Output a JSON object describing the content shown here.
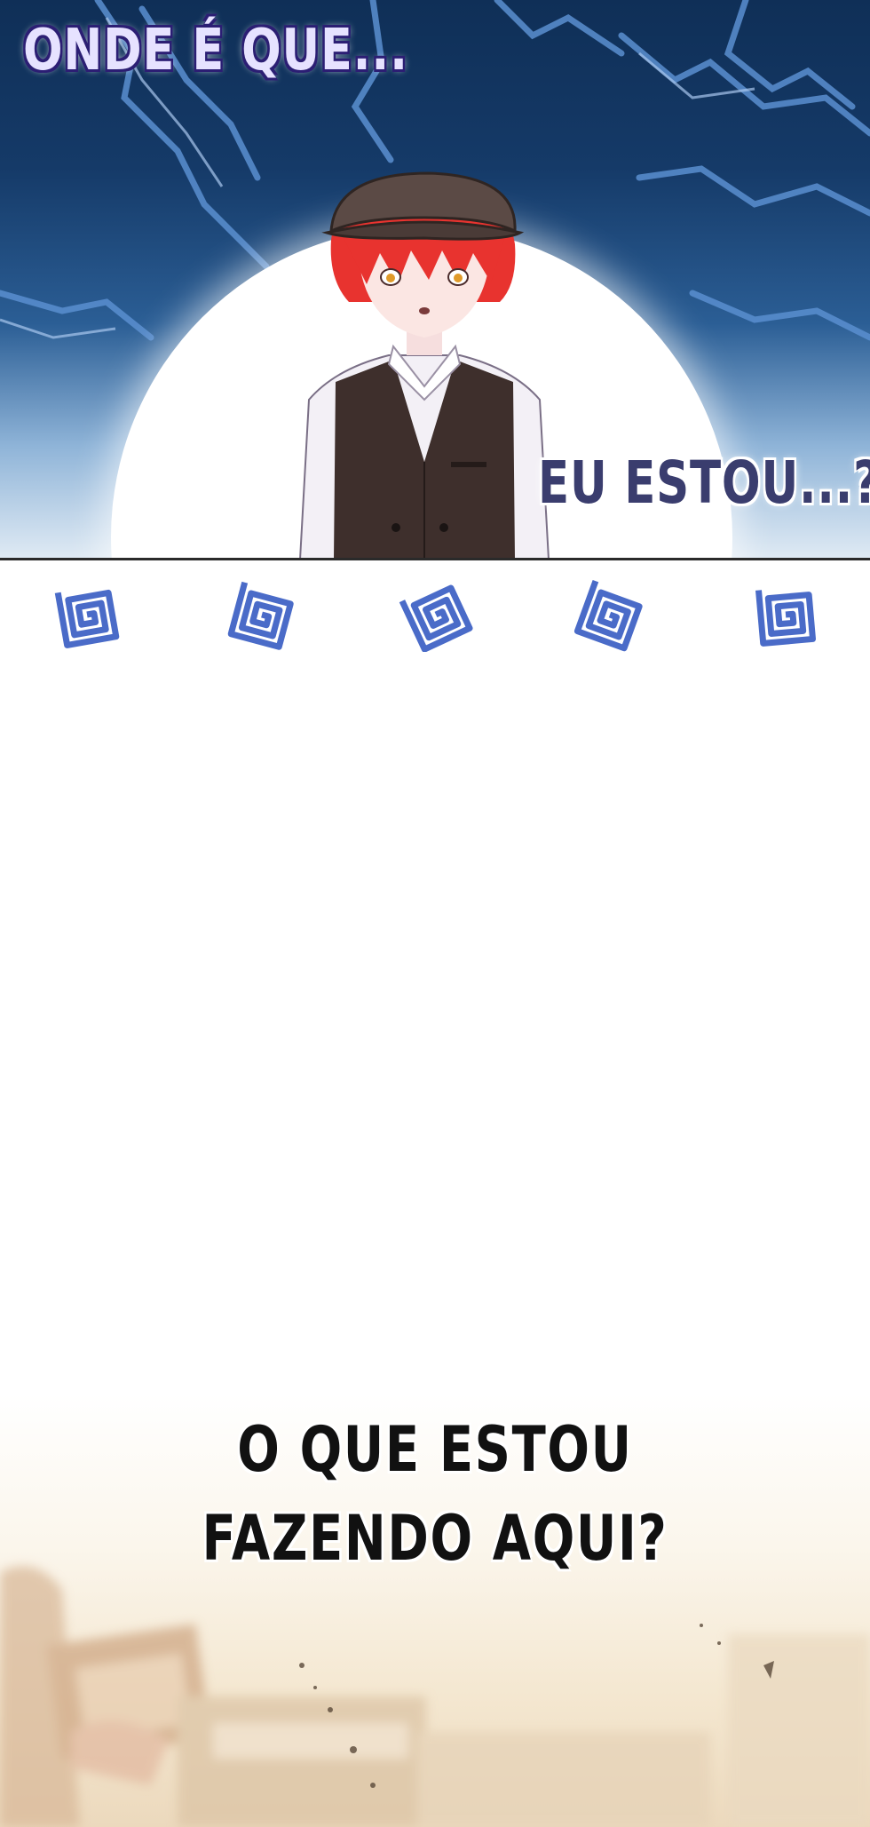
{
  "panels": {
    "top": {
      "caption_1": "ONDE É QUE...",
      "caption_2": "EU ESTOU...?"
    },
    "spirals": {
      "count": 5,
      "icon": "spiral-icon",
      "color": "#4a6bc8"
    },
    "bottom": {
      "caption_line_1": "O QUE ESTOU",
      "caption_line_2": "FAZENDO AQUI?"
    }
  },
  "colors": {
    "sky_dark": "#0f2f57",
    "sky_light": "#dfeaf4",
    "hair": "#e8332f",
    "cap": "#5b4a45",
    "vest": "#3e2f2c",
    "shirt": "#f3f0f6"
  }
}
